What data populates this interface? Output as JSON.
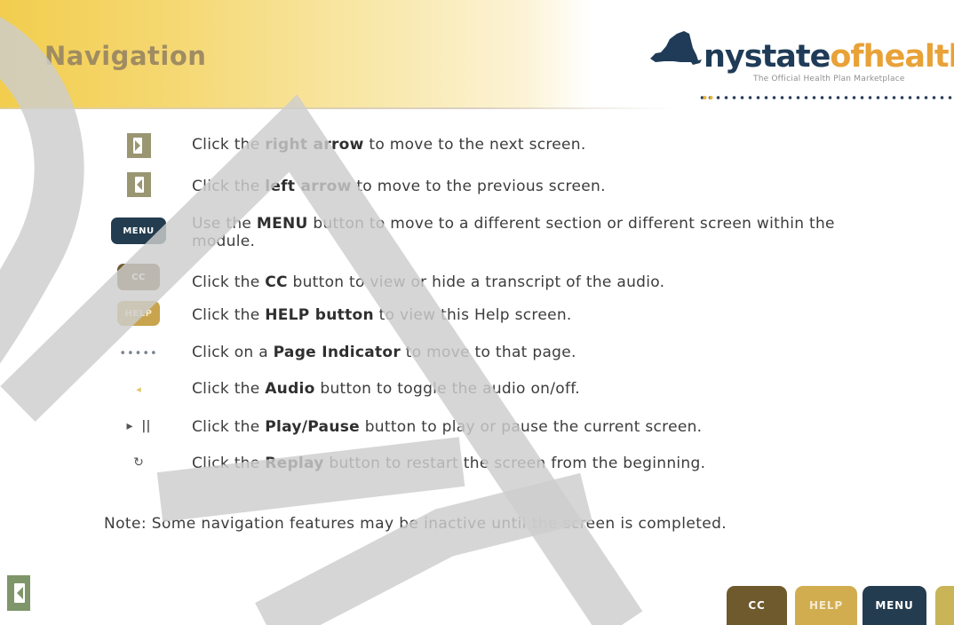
{
  "header": {
    "title": "Navigation",
    "logo": {
      "word_part1": "nystate",
      "word_part2": "ofhealth",
      "tagline": "The Official Health Plan Marketplace"
    }
  },
  "rows": [
    {
      "icon": "right-arrow-icon",
      "pre": "Click the ",
      "bold": "right arrow",
      "post": " to move to the next screen."
    },
    {
      "icon": "left-arrow-icon",
      "pre": "Click the ",
      "bold": "left arrow",
      "post": " to move to the previous screen."
    },
    {
      "icon": "menu-button-icon",
      "icon_label": "MENU",
      "pre": "Use the ",
      "bold": "MENU",
      "post": " button to move to a different section or different screen within the module."
    },
    {
      "icon": "cc-button-icon",
      "icon_label": "CC",
      "pre": "Click the ",
      "bold": "CC",
      "post": " button to view or hide a transcript of the audio."
    },
    {
      "icon": "help-button-icon",
      "icon_label": "HELP",
      "pre": "Click the ",
      "bold": "HELP button",
      "post": " to view this Help screen."
    },
    {
      "icon": "page-indicator-icon",
      "icon_label": "•••••",
      "pre": "Click on a ",
      "bold": "Page Indicator",
      "post": " to move to that page."
    },
    {
      "icon": "audio-icon",
      "icon_label": "◂",
      "pre": "Click the ",
      "bold": "Audio",
      "post": " button to toggle the audio on/off."
    },
    {
      "icon": "play-pause-icon",
      "icon_label": "▸  ||",
      "pre": "Click the ",
      "bold": "Play/Pause",
      "post": " button to play or pause the current screen."
    },
    {
      "icon": "replay-icon",
      "icon_label": "↻",
      "pre": "Click the ",
      "bold": "Replay",
      "post": " button to restart the screen from the beginning."
    }
  ],
  "note": "Note: Some navigation features may be inactive until the screen is completed.",
  "footer": {
    "cc_label": "CC",
    "help_label": "HELP",
    "menu_label": "MENU"
  },
  "colors": {
    "header_gold": "#f2cd4e",
    "navy": "#243c4f",
    "cc_brown": "#6e5a2d",
    "help_gold": "#c8a44e",
    "orange": "#e8a237"
  }
}
